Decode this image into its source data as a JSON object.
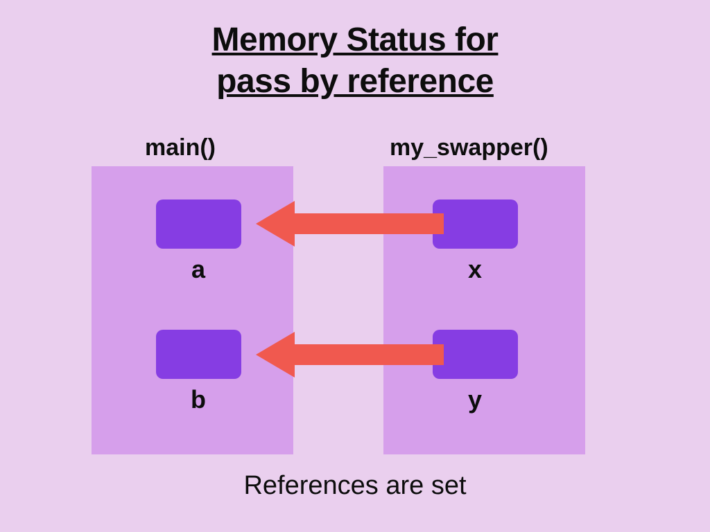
{
  "title_line1": "Memory Status for",
  "title_line2": "pass by reference",
  "functions": {
    "left": "main()",
    "right": "my_swapper()"
  },
  "vars": {
    "left_top": "a",
    "left_bot": "b",
    "right_top": "x",
    "right_bot": "y"
  },
  "caption": "References are set",
  "colors": {
    "bg": "#EACFEE",
    "panel": "#D69FEB",
    "cell": "#863DE3",
    "arrow": "#F0594F",
    "text": "#0D0D0D"
  }
}
